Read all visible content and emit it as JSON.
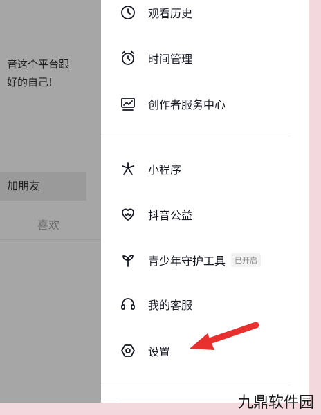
{
  "left_pane": {
    "bio_line1": "音这个平台跟",
    "bio_line2": "好的自己!",
    "add_friend_label": "加朋友",
    "likes_tab_label": "喜欢"
  },
  "menu": {
    "items": [
      {
        "label": "观看历史",
        "icon": "history-icon"
      },
      {
        "label": "时间管理",
        "icon": "alarm-clock-icon"
      },
      {
        "label": "创作者服务中心",
        "icon": "chart-monitor-icon"
      },
      {
        "label": "小程序",
        "icon": "asterisk-icon"
      },
      {
        "label": "抖音公益",
        "icon": "heart-charity-icon"
      },
      {
        "label": "青少年守护工具",
        "icon": "sprout-icon",
        "badge": "已开启"
      },
      {
        "label": "我的客服",
        "icon": "headset-icon"
      },
      {
        "label": "设置",
        "icon": "settings-hexagon-icon"
      }
    ]
  },
  "annotation": {
    "arrow_color": "#e8312f"
  },
  "watermark": "九鼎软件园"
}
